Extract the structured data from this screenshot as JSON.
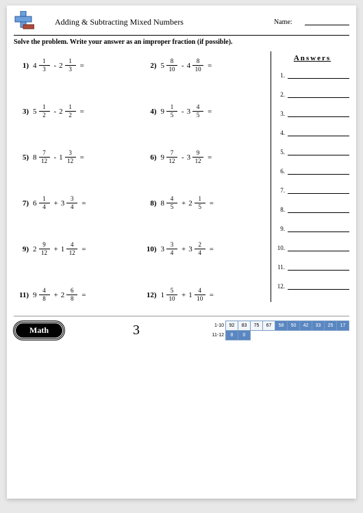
{
  "header": {
    "title": "Adding & Subtracting Mixed Numbers",
    "name_label": "Name:"
  },
  "instructions": "Solve the problem. Write your answer as an improper fraction (if possible).",
  "answers_title": "Answers",
  "page_number": "3",
  "footer_label": "Math",
  "score": {
    "row1_label": "1-10",
    "row2_label": "11-12",
    "row1": [
      "92",
      "83",
      "75",
      "67",
      "58",
      "50",
      "42",
      "33",
      "25",
      "17"
    ],
    "row2": [
      "8",
      "0"
    ]
  },
  "problems": [
    {
      "n": "1)",
      "a_w": "4",
      "a_n": "1",
      "a_d": "3",
      "op": "-",
      "b_w": "2",
      "b_n": "1",
      "b_d": "3"
    },
    {
      "n": "2)",
      "a_w": "5",
      "a_n": "8",
      "a_d": "10",
      "op": "-",
      "b_w": "4",
      "b_n": "8",
      "b_d": "10"
    },
    {
      "n": "3)",
      "a_w": "5",
      "a_n": "1",
      "a_d": "2",
      "op": "-",
      "b_w": "2",
      "b_n": "1",
      "b_d": "2"
    },
    {
      "n": "4)",
      "a_w": "9",
      "a_n": "1",
      "a_d": "5",
      "op": "-",
      "b_w": "3",
      "b_n": "4",
      "b_d": "5"
    },
    {
      "n": "5)",
      "a_w": "8",
      "a_n": "7",
      "a_d": "12",
      "op": "-",
      "b_w": "1",
      "b_n": "3",
      "b_d": "12"
    },
    {
      "n": "6)",
      "a_w": "9",
      "a_n": "7",
      "a_d": "12",
      "op": "-",
      "b_w": "3",
      "b_n": "9",
      "b_d": "12"
    },
    {
      "n": "7)",
      "a_w": "6",
      "a_n": "1",
      "a_d": "4",
      "op": "+",
      "b_w": "3",
      "b_n": "3",
      "b_d": "4"
    },
    {
      "n": "8)",
      "a_w": "8",
      "a_n": "4",
      "a_d": "5",
      "op": "+",
      "b_w": "2",
      "b_n": "1",
      "b_d": "5"
    },
    {
      "n": "9)",
      "a_w": "2",
      "a_n": "9",
      "a_d": "12",
      "op": "+",
      "b_w": "1",
      "b_n": "4",
      "b_d": "12"
    },
    {
      "n": "10)",
      "a_w": "3",
      "a_n": "3",
      "a_d": "4",
      "op": "+",
      "b_w": "3",
      "b_n": "2",
      "b_d": "4"
    },
    {
      "n": "11)",
      "a_w": "9",
      "a_n": "4",
      "a_d": "8",
      "op": "+",
      "b_w": "2",
      "b_n": "6",
      "b_d": "8"
    },
    {
      "n": "12)",
      "a_w": "1",
      "a_n": "5",
      "a_d": "10",
      "op": "+",
      "b_w": "1",
      "b_n": "4",
      "b_d": "10"
    }
  ],
  "answer_numbers": [
    "1.",
    "2.",
    "3.",
    "4.",
    "5.",
    "6.",
    "7.",
    "8.",
    "9.",
    "10.",
    "11.",
    "12."
  ]
}
